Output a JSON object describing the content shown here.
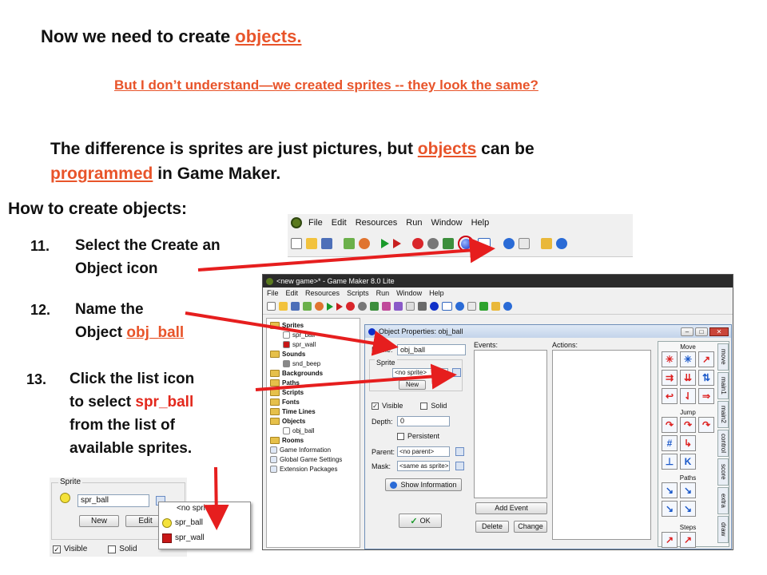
{
  "slide": {
    "title_prefix": "Now we need to create ",
    "title_link": "objects.",
    "question": "But I don’t understand—we created sprites -- they look the same?",
    "diff_part1": "The difference is sprites are just pictures, but ",
    "diff_link1": "objects",
    "diff_part2": " can be",
    "diff_link2": "programmed",
    "diff_part3": " in Game Maker.",
    "howto": "How to create objects:",
    "step11_num": "11.",
    "step11_line1": "Select the Create an",
    "step11_line2": "Object  icon",
    "step12_num": "12.",
    "step12_line1": "Name the",
    "step12_line2_prefix": "Object ",
    "step12_line2_link": "obj_ball",
    "step13_num": "13.",
    "step13_line1": "Click the list icon",
    "step13_line2": "to select ",
    "step13_line2_red": "spr_ball",
    "step13_line3": "from the list of",
    "step13_line4": "available sprites."
  },
  "toolbar1": {
    "menu": [
      "File",
      "Edit",
      "Resources",
      "Run",
      "Window",
      "Help"
    ]
  },
  "gm_window": {
    "title": "<new game>* - Game Maker 8.0 Lite",
    "menu": [
      "File",
      "Edit",
      "Resources",
      "Scripts",
      "Run",
      "Window",
      "Help"
    ],
    "tree": [
      {
        "label": "Sprites",
        "level": 0,
        "type": "folder"
      },
      {
        "label": "spr_ball",
        "level": 1,
        "type": "item"
      },
      {
        "label": "spr_wall",
        "level": 1,
        "type": "item"
      },
      {
        "label": "Sounds",
        "level": 0,
        "type": "folder"
      },
      {
        "label": "snd_beep",
        "level": 1,
        "type": "item"
      },
      {
        "label": "Backgrounds",
        "level": 0,
        "type": "folder"
      },
      {
        "label": "Paths",
        "level": 0,
        "type": "folder"
      },
      {
        "label": "Scripts",
        "level": 0,
        "type": "folder"
      },
      {
        "label": "Fonts",
        "level": 0,
        "type": "folder"
      },
      {
        "label": "Time Lines",
        "level": 0,
        "type": "folder"
      },
      {
        "label": "Objects",
        "level": 0,
        "type": "folder"
      },
      {
        "label": "obj_ball",
        "level": 1,
        "type": "item"
      },
      {
        "label": "Rooms",
        "level": 0,
        "type": "folder"
      },
      {
        "label": "Game Information",
        "level": 0,
        "type": "item"
      },
      {
        "label": "Global Game Settings",
        "level": 0,
        "type": "item"
      },
      {
        "label": "Extension Packages",
        "level": 0,
        "type": "item"
      }
    ]
  },
  "obj_props": {
    "title": "Object Properties: obj_ball",
    "name_label": "Name:",
    "name_value": "obj_ball",
    "sprite_label": "Sprite",
    "sprite_value": "<no sprite>",
    "new_btn": "New",
    "visible_label": "Visible",
    "solid_label": "Solid",
    "depth_label": "Depth:",
    "depth_value": "0",
    "persistent_label": "Persistent",
    "parent_label": "Parent:",
    "parent_value": "<no parent>",
    "mask_label": "Mask:",
    "mask_value": "<same as sprite>",
    "show_info_btn": "Show Information",
    "ok_btn": "OK",
    "events_label": "Events:",
    "actions_label": "Actions:",
    "add_event_btn": "Add Event",
    "delete_btn": "Delete",
    "change_btn": "Change",
    "groups": [
      "Move",
      "Jump",
      "Paths",
      "Steps"
    ],
    "tabs": [
      "move",
      "main1",
      "main2",
      "control",
      "score",
      "extra",
      "draw"
    ]
  },
  "inset": {
    "sprite_label": "Sprite",
    "sprite_value": "spr_ball",
    "new_btn": "New",
    "edit_btn": "Edit",
    "visible_label": "Visible",
    "solid_label": "Solid",
    "dropdown": [
      "<no sprite>",
      "spr_ball",
      "spr_wall"
    ]
  },
  "colors": {
    "highlight": "#e8542a",
    "arrow": "#e61e1e",
    "red_text": "#e3281c"
  }
}
